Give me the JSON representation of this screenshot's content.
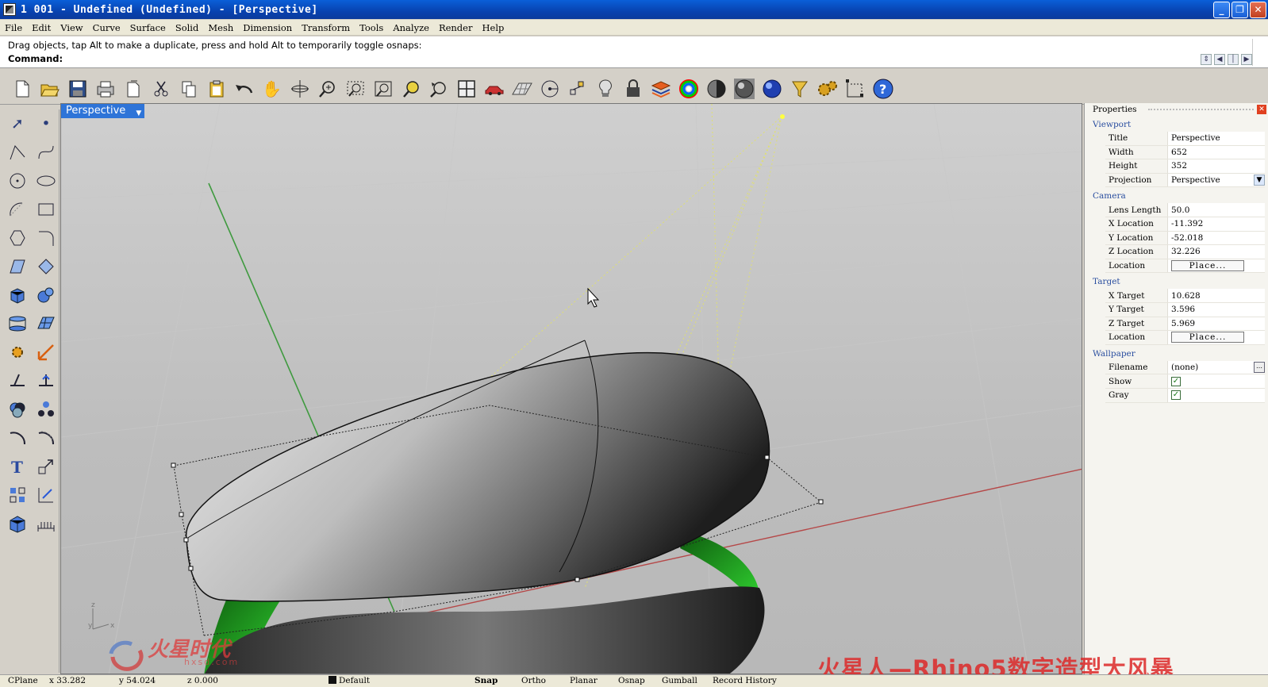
{
  "window": {
    "title": "1 001 - Undefined (Undefined) - [Perspective]",
    "controls": [
      "minimize",
      "restore",
      "close"
    ]
  },
  "menu": [
    "File",
    "Edit",
    "View",
    "Curve",
    "Surface",
    "Solid",
    "Mesh",
    "Dimension",
    "Transform",
    "Tools",
    "Analyze",
    "Render",
    "Help"
  ],
  "command": {
    "history": "Drag objects, tap Alt to make a duplicate, press and hold Alt to temporarily toggle osnaps:",
    "label": "Command:",
    "value": ""
  },
  "toolbar": [
    "new-icon",
    "open-icon",
    "save-icon",
    "print-icon",
    "import-icon",
    "cut-icon",
    "copy-icon",
    "paste-icon",
    "undo-icon",
    "pan-icon",
    "rotate-view-icon",
    "zoom-icon",
    "zoom-window-icon",
    "zoom-extents-icon",
    "zoom-selected-icon",
    "undo-view-icon",
    "four-viewports-icon",
    "car-icon",
    "grid-icon",
    "circle-icon",
    "point-icon",
    "light-icon",
    "lock-icon",
    "layer-icon",
    "color-wheel-icon",
    "shaded-sphere-icon",
    "render-sphere-icon",
    "blue-sphere-icon",
    "filter-icon",
    "settings-gear-icon",
    "dimension-icon",
    "help-icon"
  ],
  "viewport": {
    "label": "Perspective"
  },
  "properties": {
    "header": "Properties",
    "sections": [
      {
        "name": "Viewport",
        "rows": [
          {
            "k": "Title",
            "v": "Perspective"
          },
          {
            "k": "Width",
            "v": "652"
          },
          {
            "k": "Height",
            "v": "352"
          },
          {
            "k": "Projection",
            "v": "Perspective"
          }
        ]
      },
      {
        "name": "Camera",
        "rows": [
          {
            "k": "Lens Length",
            "v": "50.0"
          },
          {
            "k": "X Location",
            "v": "-11.392"
          },
          {
            "k": "Y Location",
            "v": "-52.018"
          },
          {
            "k": "Z Location",
            "v": "32.226"
          },
          {
            "k": "Location",
            "v": "Place..."
          }
        ]
      },
      {
        "name": "Target",
        "rows": [
          {
            "k": "X Target",
            "v": "10.628"
          },
          {
            "k": "Y Target",
            "v": "3.596"
          },
          {
            "k": "Z Target",
            "v": "5.969"
          },
          {
            "k": "Location",
            "v": "Place..."
          }
        ]
      },
      {
        "name": "Wallpaper",
        "rows": [
          {
            "k": "Filename",
            "v": "(none)"
          },
          {
            "k": "Show",
            "v": "checked"
          },
          {
            "k": "Gray",
            "v": "checked"
          }
        ]
      }
    ]
  },
  "status": {
    "cplane": "CPlane",
    "x": "x 33.282",
    "y": "y 54.024",
    "z": "z 0.000",
    "layer": "Default",
    "toggles": [
      "Snap",
      "Ortho",
      "Planar",
      "Osnap",
      "Gumball",
      "Record History"
    ]
  },
  "watermark": {
    "logo_text": "火星时代",
    "logo_url": "hxsd.com",
    "caption": "火星人—Rhino5数字造型大风暴"
  },
  "colors": {
    "title_blue": "#0842b0",
    "viewport_tab": "#2e74d8",
    "surface_green": "#22c322",
    "axis_red": "#b54848",
    "axis_green": "#3f9a3f"
  }
}
